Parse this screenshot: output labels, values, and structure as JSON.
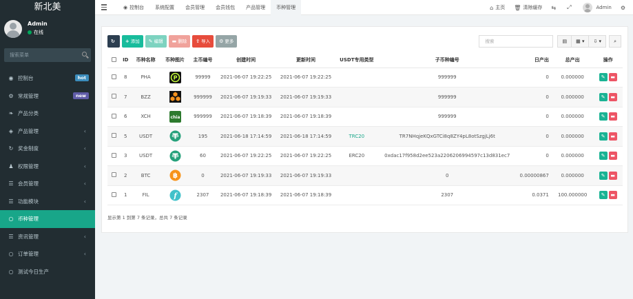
{
  "brand": "新北美",
  "user": {
    "name": "Admin",
    "status": "在线"
  },
  "sidebar": {
    "search_placeholder": "搜索菜单",
    "items": [
      {
        "label": "控制台",
        "icon": "dashboard-icon",
        "glyph": "◉",
        "badge": "hot",
        "badge_color": "#3c8dbc"
      },
      {
        "label": "常规管理",
        "icon": "cogs-icon",
        "glyph": "⚙",
        "badge": "new",
        "badge_color": "#605ca8"
      },
      {
        "label": "产品分类",
        "icon": "leaf-icon",
        "glyph": "❧",
        "badge": null
      },
      {
        "label": "产品管理",
        "icon": "diamond-icon",
        "glyph": "◈",
        "badge": null,
        "caret": "‹"
      },
      {
        "label": "奖金制度",
        "icon": "refresh-icon",
        "glyph": "↻",
        "badge": null,
        "caret": "‹"
      },
      {
        "label": "权限管理",
        "icon": "group-icon",
        "glyph": "♟",
        "badge": null,
        "caret": "‹"
      },
      {
        "label": "会员管理",
        "icon": "list-icon",
        "glyph": "☰",
        "badge": null,
        "caret": "‹"
      },
      {
        "label": "功能模块",
        "icon": "list-icon",
        "glyph": "☰",
        "badge": null,
        "caret": "‹"
      },
      {
        "label": "币种管理",
        "icon": "circle-icon",
        "glyph": "○",
        "badge": null,
        "active": true
      },
      {
        "label": "资讯管理",
        "icon": "list-icon",
        "glyph": "☰",
        "badge": null,
        "caret": "‹"
      },
      {
        "label": "订单管理",
        "icon": "circle-icon",
        "glyph": "○",
        "badge": null,
        "caret": "‹"
      },
      {
        "label": "测试今日生产",
        "icon": "circle-icon",
        "glyph": "○",
        "badge": null
      }
    ]
  },
  "topbar": {
    "tabs": [
      {
        "label": "控制台",
        "icon": "dashboard-icon",
        "glyph": "◉"
      },
      {
        "label": "系统配置"
      },
      {
        "label": "会员管理"
      },
      {
        "label": "会员钱包"
      },
      {
        "label": "产品管理"
      },
      {
        "label": "币种管理",
        "active": true
      }
    ],
    "home": "主页",
    "clear_cache": "清除缓存",
    "admin": "Admin"
  },
  "toolbar": {
    "add": "添加",
    "edit": "编辑",
    "delete": "删除",
    "import": "导入",
    "more": "更多",
    "search_placeholder": "搜索"
  },
  "table": {
    "headers": [
      "ID",
      "币种名称",
      "币种图片",
      "主币编号",
      "创建时间",
      "更新时间",
      "USDT专用类型",
      "子币种编号",
      "日产出",
      "总产出",
      "操作"
    ],
    "rows": [
      {
        "id": "8",
        "name": "PHA",
        "coin": "pha",
        "main_no": "99999",
        "created": "2021-06-07 19:22:25",
        "updated": "2021-06-07 19:22:25",
        "usdt_type": "",
        "sub_no": "999999",
        "daily": "0",
        "total": "0.000000"
      },
      {
        "id": "7",
        "name": "BZZ",
        "coin": "bzz",
        "main_no": "999999",
        "created": "2021-06-07 19:19:33",
        "updated": "2021-06-07 19:19:33",
        "usdt_type": "",
        "sub_no": "999999",
        "daily": "0",
        "total": "0.000000"
      },
      {
        "id": "6",
        "name": "XCH",
        "coin": "xch",
        "main_no": "999999",
        "created": "2021-06-07 19:18:39",
        "updated": "2021-06-07 19:18:39",
        "usdt_type": "",
        "sub_no": "999999",
        "daily": "0",
        "total": "0.000000"
      },
      {
        "id": "5",
        "name": "USDT",
        "coin": "usdt",
        "main_no": "195",
        "created": "2021-06-18 17:14:59",
        "updated": "2021-06-18 17:14:59",
        "usdt_type": "TRC20",
        "sub_no": "TR7NHqjeKQxGTCi8q8ZY4pL8otSzgjLj6t",
        "daily": "0",
        "total": "0.000000"
      },
      {
        "id": "3",
        "name": "USDT",
        "coin": "usdt",
        "main_no": "60",
        "created": "2021-06-07 19:22:25",
        "updated": "2021-06-07 19:22:25",
        "usdt_type": "ERC20",
        "sub_no": "0xdac17f958d2ee523a2206206994597c13d831ec7",
        "daily": "0",
        "total": "0.000000"
      },
      {
        "id": "2",
        "name": "BTC",
        "coin": "btc",
        "main_no": "0",
        "created": "2021-06-07 19:19:33",
        "updated": "2021-06-07 19:19:33",
        "usdt_type": "",
        "sub_no": "0",
        "daily": "0.00000867",
        "total": "0.000000"
      },
      {
        "id": "1",
        "name": "FIL",
        "coin": "fil",
        "main_no": "2307",
        "created": "2021-06-07 19:18:39",
        "updated": "2021-06-07 19:18:39",
        "usdt_type": "",
        "sub_no": "2307",
        "daily": "0.0371",
        "total": "100.000000"
      }
    ]
  },
  "footer": "显示第 1 到第 7 条记录，总共 7 条记录",
  "colors": {
    "sidebar_bg": "#222d32",
    "active_green": "#18a689",
    "btn_refresh": "#2c3e50",
    "btn_add": "#18bc9c",
    "btn_edit": "#7dd3c0",
    "btn_delete": "#f0a29b",
    "btn_import": "#e74c3c",
    "btn_more": "#95a5a6"
  }
}
